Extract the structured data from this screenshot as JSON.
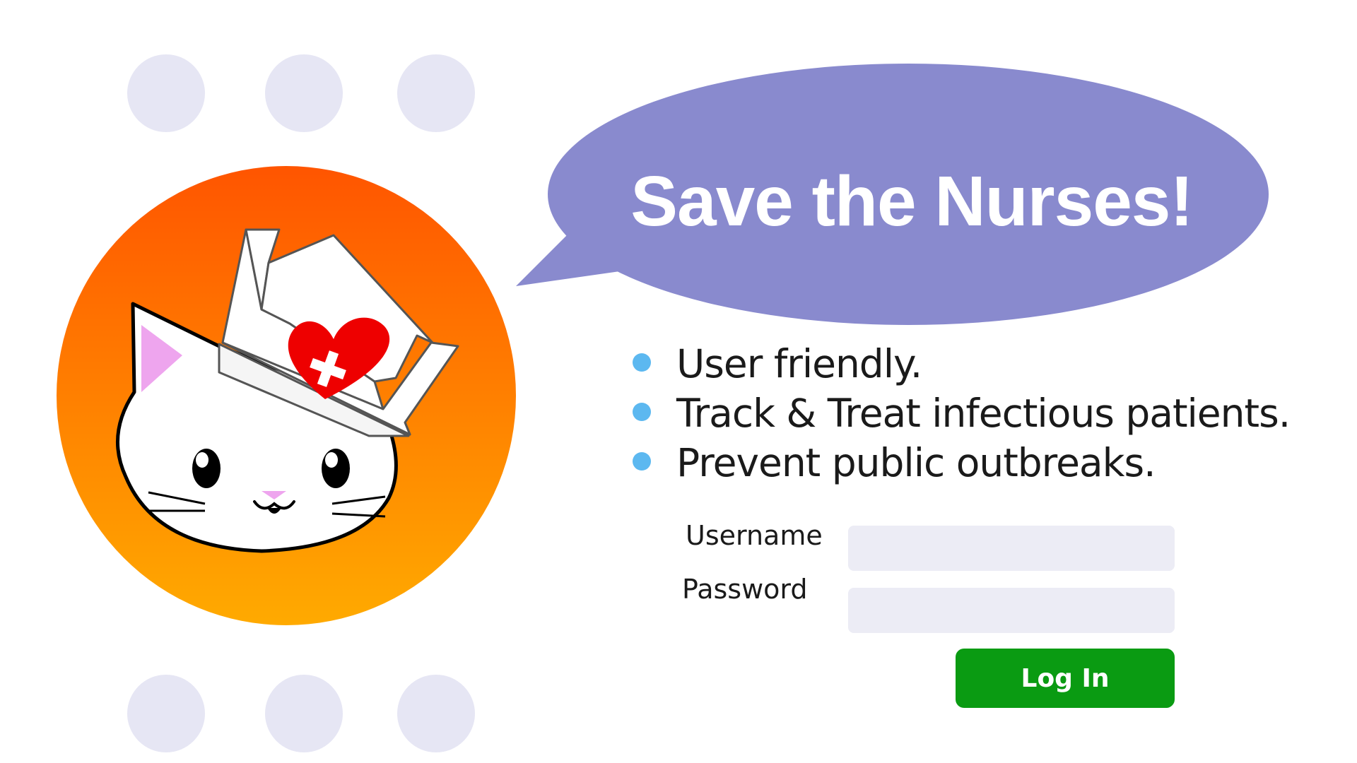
{
  "colors": {
    "bubble": "#898ace",
    "decorative_dots": "#e6e6f4",
    "logo_gradient_top": "#ff5500",
    "logo_gradient_bottom": "#ffaa00",
    "bullet": "#5cb8f0",
    "input_background": "#ececf5",
    "login_button": "#0a9b12",
    "heart": "#ee0000"
  },
  "icons": [
    "nurse-cat-logo-icon",
    "heart-cross-icon",
    "bullet-dot-icon"
  ],
  "hero": {
    "title": "Save the Nurses!"
  },
  "features": [
    {
      "text": "User friendly."
    },
    {
      "text": "Track & Treat infectious patients."
    },
    {
      "text": "Prevent public outbreaks."
    }
  ],
  "login": {
    "username_label": "Username",
    "username_value": "",
    "password_label": "Password",
    "password_value": "",
    "submit_label": "Log In"
  }
}
